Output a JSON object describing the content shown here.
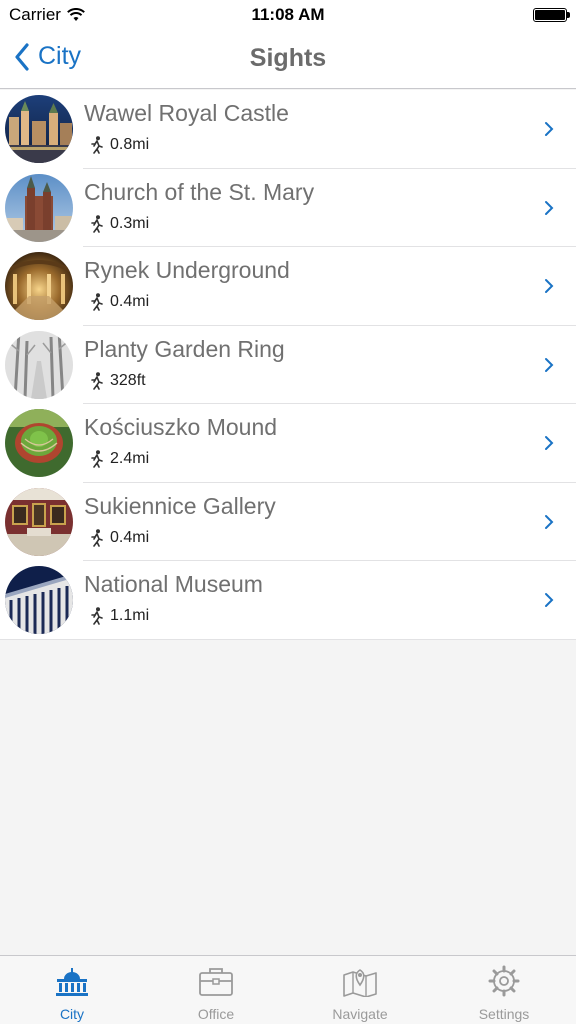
{
  "status_bar": {
    "carrier": "Carrier",
    "time": "11:08 AM"
  },
  "nav": {
    "back_label": "City",
    "title": "Sights"
  },
  "sights": [
    {
      "name": "Wawel Royal Castle",
      "distance": "0.8mi",
      "thumb": "castle-night"
    },
    {
      "name": "Church of the St. Mary",
      "distance": "0.3mi",
      "thumb": "church-towers"
    },
    {
      "name": "Rynek Underground",
      "distance": "0.4mi",
      "thumb": "underground-hall"
    },
    {
      "name": "Planty Garden Ring",
      "distance": "328ft",
      "thumb": "foggy-park"
    },
    {
      "name": "Kościuszko Mound",
      "distance": "2.4mi",
      "thumb": "green-mound"
    },
    {
      "name": "Sukiennice Gallery",
      "distance": "0.4mi",
      "thumb": "gallery-room"
    },
    {
      "name": "National Museum",
      "distance": "1.1mi",
      "thumb": "museum-building"
    }
  ],
  "tabs": [
    {
      "label": "City",
      "icon": "capitol-icon",
      "active": true
    },
    {
      "label": "Office",
      "icon": "briefcase-icon",
      "active": false
    },
    {
      "label": "Navigate",
      "icon": "map-icon",
      "active": false
    },
    {
      "label": "Settings",
      "icon": "gear-icon",
      "active": false
    }
  ],
  "colors": {
    "accent": "#1a73c5",
    "text_gray": "#707070",
    "inactive_tab": "#9a9a9a"
  }
}
